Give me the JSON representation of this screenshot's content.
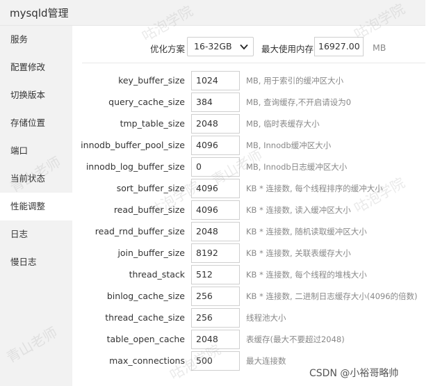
{
  "window": {
    "title": "mysqld管理"
  },
  "sidebar": {
    "items": [
      {
        "label": "服务"
      },
      {
        "label": "配置修改"
      },
      {
        "label": "切换版本"
      },
      {
        "label": "存储位置"
      },
      {
        "label": "端口"
      },
      {
        "label": "当前状态"
      },
      {
        "label": "性能调整",
        "active": true
      },
      {
        "label": "日志"
      },
      {
        "label": "慢日志"
      }
    ]
  },
  "optimize": {
    "label": "优化方案",
    "selected": "16-32GB",
    "max_mem_label": "最大使用内存",
    "max_mem_value": "16927.00",
    "max_mem_unit": "MB"
  },
  "params": [
    {
      "name": "key_buffer_size",
      "value": "1024",
      "note": "MB, 用于索引的缓冲区大小"
    },
    {
      "name": "query_cache_size",
      "value": "384",
      "note": "MB, 查询缓存,不开启请设为0"
    },
    {
      "name": "tmp_table_size",
      "value": "2048",
      "note": "MB, 临时表缓存大小"
    },
    {
      "name": "innodb_buffer_pool_size",
      "value": "4096",
      "note": "MB, Innodb缓冲区大小"
    },
    {
      "name": "innodb_log_buffer_size",
      "value": "0",
      "note": "MB, Innodb日志缓冲区大小"
    },
    {
      "name": "sort_buffer_size",
      "value": "4096",
      "note": "KB * 连接数, 每个线程排序的缓冲大小"
    },
    {
      "name": "read_buffer_size",
      "value": "4096",
      "note": "KB * 连接数, 读入缓冲区大小"
    },
    {
      "name": "read_rnd_buffer_size",
      "value": "2048",
      "note": "KB * 连接数, 随机读取缓冲区大小"
    },
    {
      "name": "join_buffer_size",
      "value": "8192",
      "note": "KB * 连接数, 关联表缓存大小"
    },
    {
      "name": "thread_stack",
      "value": "512",
      "note": "KB * 连接数, 每个线程的堆栈大小"
    },
    {
      "name": "binlog_cache_size",
      "value": "256",
      "note": "KB * 连接数, 二进制日志缓存大小(4096的倍数)"
    },
    {
      "name": "thread_cache_size",
      "value": "256",
      "note": "线程池大小"
    },
    {
      "name": "table_open_cache",
      "value": "2048",
      "note": "表缓存(最大不要超过2048)"
    },
    {
      "name": "max_connections",
      "value": "500",
      "note": "最大连接数"
    }
  ],
  "watermarks": [
    "咕泡学院",
    "青山老师"
  ],
  "credit": "CSDN @小裕哥略帅",
  "icons": {
    "select_arrow": "chevron-down-icon"
  }
}
